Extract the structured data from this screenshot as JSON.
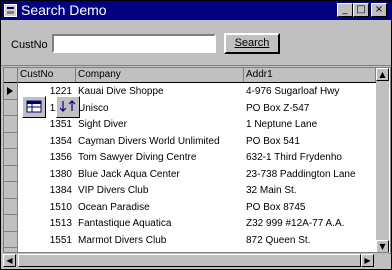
{
  "window": {
    "title": "Search Demo"
  },
  "titlebar_buttons": {
    "minimize": "_",
    "maximize": "□",
    "close": "×"
  },
  "search": {
    "label": "CustNo",
    "value": "",
    "button_label": "Search"
  },
  "grid": {
    "columns": [
      "CustNo",
      "Company",
      "Addr1"
    ],
    "rows": [
      {
        "custno": "1221",
        "company": "Kauai Dive Shoppe",
        "addr1": "4-976 Sugarloaf Hwy"
      },
      {
        "custno": "1231",
        "company": "Unisco",
        "addr1": "PO Box Z-547"
      },
      {
        "custno": "1351",
        "company": "Sight Diver",
        "addr1": "1 Neptune Lane"
      },
      {
        "custno": "1354",
        "company": "Cayman Divers World Unlimited",
        "addr1": "PO Box 541"
      },
      {
        "custno": "1356",
        "company": "Tom Sawyer Diving Centre",
        "addr1": "632-1 Third Frydenho"
      },
      {
        "custno": "1380",
        "company": "Blue Jack Aqua Center",
        "addr1": "23-738 Paddington Lane"
      },
      {
        "custno": "1384",
        "company": "VIP Divers Club",
        "addr1": "32 Main St."
      },
      {
        "custno": "1510",
        "company": "Ocean Paradise",
        "addr1": "PO Box 8745"
      },
      {
        "custno": "1513",
        "company": "Fantastique Aquatica",
        "addr1": "Z32 999 #12A-77 A.A."
      },
      {
        "custno": "1551",
        "company": "Marmot Divers Club",
        "addr1": "872 Queen St."
      }
    ]
  },
  "colors": {
    "titlebar": "#000080",
    "face": "#c0c0c0"
  },
  "icons": {
    "floating_1": "grid-icon",
    "floating_2": "sort-icon"
  }
}
